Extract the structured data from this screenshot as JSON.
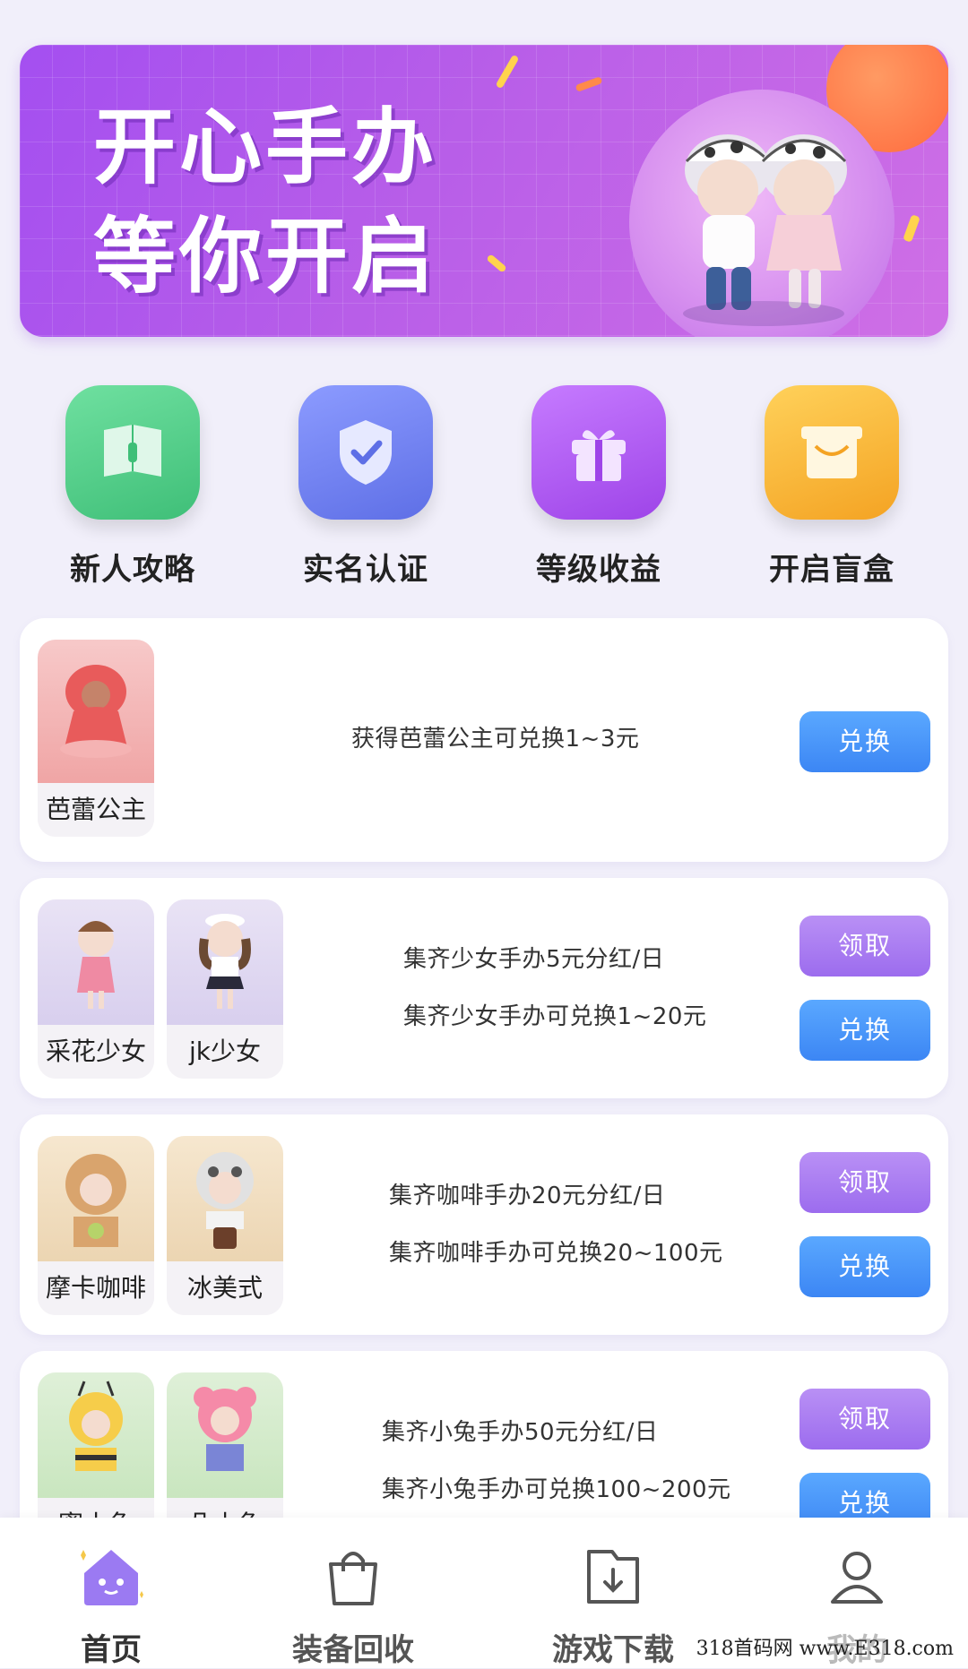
{
  "banner": {
    "line1": "开心手办",
    "line2": "等你开启"
  },
  "quick_actions": [
    {
      "label": "新人攻略",
      "icon": "book-icon",
      "color": "#4fce8a"
    },
    {
      "label": "实名认证",
      "icon": "shield-check-icon",
      "color": "#6f80ef"
    },
    {
      "label": "等级收益",
      "icon": "gift-icon",
      "color": "#b45cf0"
    },
    {
      "label": "开启盲盒",
      "icon": "box-icon",
      "color": "#fbb53b"
    }
  ],
  "cards": [
    {
      "items": [
        "芭蕾公主"
      ],
      "lines": [
        "获得芭蕾公主可兑换1~3元"
      ],
      "buttons": [
        {
          "label": "兑换",
          "style": "blue"
        }
      ]
    },
    {
      "items": [
        "采花少女",
        "jk少女"
      ],
      "lines": [
        "集齐少女手办5元分红/日",
        "集齐少女手办可兑换1~20元"
      ],
      "buttons": [
        {
          "label": "领取",
          "style": "purple"
        },
        {
          "label": "兑换",
          "style": "blue"
        }
      ]
    },
    {
      "items": [
        "摩卡咖啡",
        "冰美式"
      ],
      "lines": [
        "集齐咖啡手办20元分红/日",
        "集齐咖啡手办可兑换20~100元"
      ],
      "buttons": [
        {
          "label": "领取",
          "style": "purple"
        },
        {
          "label": "兑换",
          "style": "blue"
        }
      ]
    },
    {
      "items": [
        "蜜小兔",
        "朵小兔"
      ],
      "lines": [
        "集齐小兔手办50元分红/日",
        "集齐小兔手办可兑换100~200元"
      ],
      "buttons": [
        {
          "label": "领取",
          "style": "purple"
        },
        {
          "label": "兑换",
          "style": "blue"
        }
      ]
    }
  ],
  "nav": [
    {
      "label": "首页",
      "icon": "home-icon",
      "active": true
    },
    {
      "label": "装备回收",
      "icon": "shopping-bag-icon",
      "active": false
    },
    {
      "label": "游戏下载",
      "icon": "download-icon",
      "active": false
    },
    {
      "label": "我的",
      "icon": "user-icon",
      "active": false
    }
  ],
  "watermark": "318首码网 www.E318.com"
}
